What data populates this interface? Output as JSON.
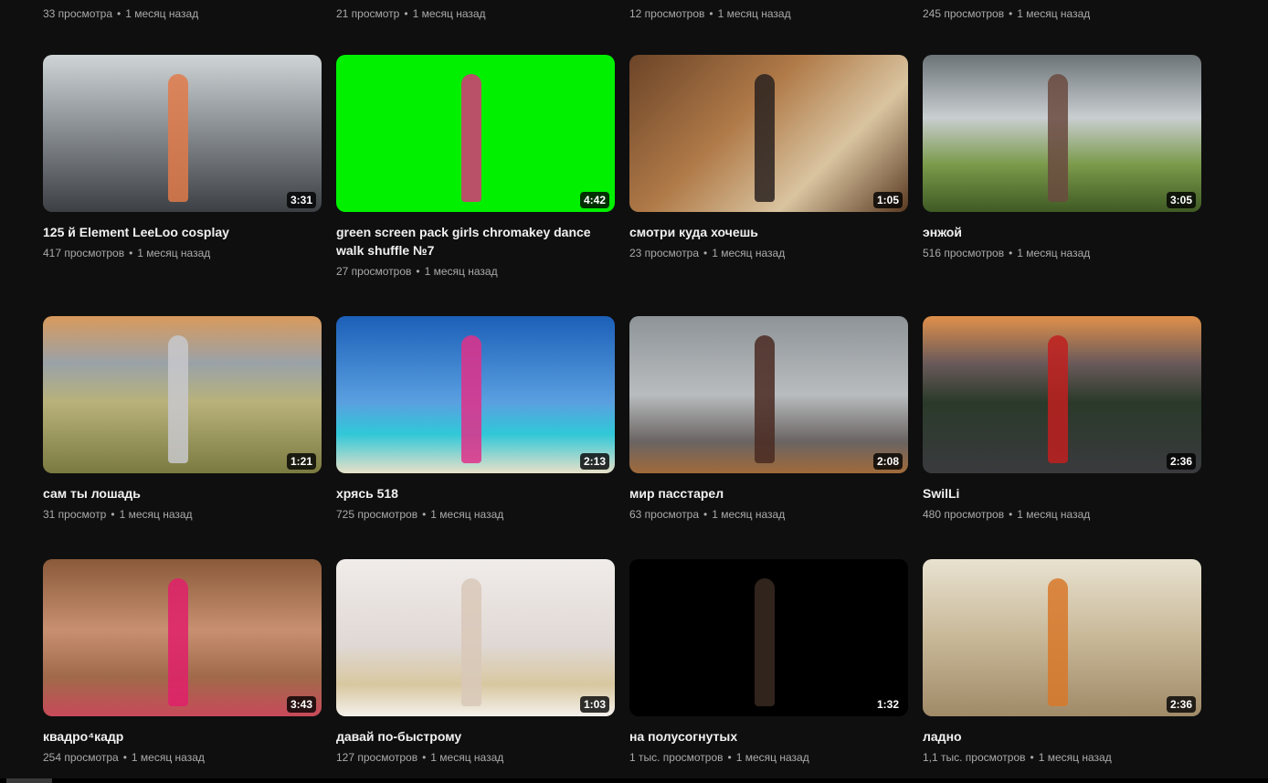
{
  "previous_row": [
    {
      "views": "33 просмотра",
      "age": "1 месяц назад"
    },
    {
      "views": "21 просмотр",
      "age": "1 месяц назад"
    },
    {
      "views": "12 просмотров",
      "age": "1 месяц назад"
    },
    {
      "views": "245 просмотров",
      "age": "1 месяц назад"
    }
  ],
  "videos": [
    {
      "title": "125 й Element LeeLoo cosplay",
      "views": "417 просмотров",
      "age": "1 месяц назад",
      "duration": "3:31",
      "thumb": "linear-gradient(180deg,#cfd4d6 0%,#8c9196 45%,#3c4044 100%)",
      "fig": "#e07a4a"
    },
    {
      "title": "green screen pack girls chromakey dance walk shuffle №7",
      "views": "27 просмотров",
      "age": "1 месяц назад",
      "duration": "4:42",
      "thumb": "#00f000",
      "fig": "#d9357a"
    },
    {
      "title": "смотри куда хочешь",
      "views": "23 просмотра",
      "age": "1 месяц назад",
      "duration": "1:05",
      "thumb": "linear-gradient(135deg,#6b4428 0%,#b07a48 40%,#d9c4a0 70%,#5a3a22 100%)",
      "fig": "#2a2220"
    },
    {
      "title": "энжой",
      "views": "516 просмотров",
      "age": "1 месяц назад",
      "duration": "3:05",
      "thumb": "linear-gradient(180deg,#6c7478 0%,#c9ced0 40%,#7a9a4a 70%,#3f5a24 100%)",
      "fig": "#6a4a40"
    },
    {
      "title": "сам ты лошадь",
      "views": "31 просмотр",
      "age": "1 месяц назад",
      "duration": "1:21",
      "thumb": "linear-gradient(180deg,#d89a5c 0%,#9aa2a8 30%,#b8b27a 55%,#7a7a40 100%)",
      "fig": "#c8c8cc"
    },
    {
      "title": "хрясь 518",
      "views": "725 просмотров",
      "age": "1 месяц назад",
      "duration": "2:13",
      "thumb": "linear-gradient(180deg,#1c5fb8 0%,#5aa0e0 55%,#30c8d8 75%,#e8e0c8 100%)",
      "fig": "#e0308a"
    },
    {
      "title": "мир пасстарел",
      "views": "63 просмотра",
      "age": "1 месяц назад",
      "duration": "2:08",
      "thumb": "linear-gradient(180deg,#8e9498 0%,#b8bcbe 50%,#6a6462 80%,#a06a3a 100%)",
      "fig": "#4a2a22"
    },
    {
      "title": "SwilLi",
      "views": "480 просмотров",
      "age": "1 месяц назад",
      "duration": "2:36",
      "thumb": "linear-gradient(180deg,#e0904a 0%,#6a5a5a 30%,#2a3a2a 55%,#3a3a3e 100%)",
      "fig": "#c02020"
    },
    {
      "title": "квадро⁴кадр",
      "views": "254 просмотра",
      "age": "1 месяц назад",
      "duration": "3:43",
      "thumb": "linear-gradient(180deg,#8a5a3a 0%,#c89070 45%,#a06a4a 75%,#c84a5a 100%)",
      "fig": "#e0206a"
    },
    {
      "title": "давай по-быстрому",
      "views": "127 просмотров",
      "age": "1 месяц назад",
      "duration": "1:03",
      "thumb": "linear-gradient(180deg,#f0ecea 0%,#e0d8d4 55%,#d8c8a0 80%,#f4f0ec 100%)",
      "fig": "#d8c8b8"
    },
    {
      "title": "на полусогнутых",
      "views": "1 тыс. просмотров",
      "age": "1 месяц назад",
      "duration": "1:32",
      "thumb": "#000000",
      "fig": "#3a2a22"
    },
    {
      "title": "ладно",
      "views": "1,1 тыс. просмотров",
      "age": "1 месяц назад",
      "duration": "2:36",
      "thumb": "linear-gradient(180deg,#e8e2d0 0%,#c8b898 50%,#a08a68 100%)",
      "fig": "#d8782a"
    }
  ]
}
